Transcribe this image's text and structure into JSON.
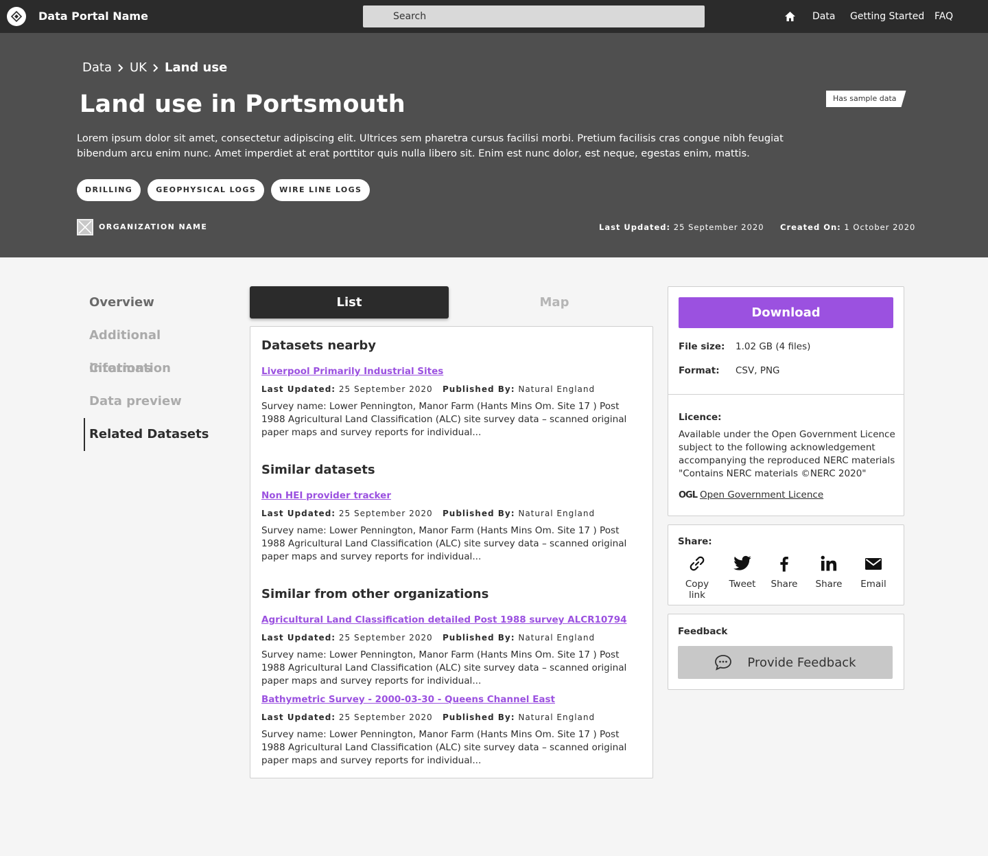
{
  "header": {
    "portal_name": "Data Portal Name",
    "search_placeholder": "Search",
    "nav": [
      "Data",
      "Getting Started",
      "FAQ"
    ]
  },
  "hero": {
    "breadcrumb": [
      "Data",
      "UK",
      "Land use"
    ],
    "title": "Land use in Portsmouth",
    "badge": "Has sample data",
    "description": "Lorem ipsum dolor sit amet, consectetur adipiscing elit. Ultrices sem pharetra cursus facilisi morbi. Pretium facilisis cras congue nibh feugiat bibendum arcu enim nunc. Amet imperdiet at erat porttitor quis nulla libero sit. Enim est nunc dolor, est neque, egestas enim, mattis.",
    "tags": [
      "DRILLING",
      "GEOPHYSICAL LOGS",
      "WIRE LINE LOGS"
    ],
    "organization": "ORGANIZATION NAME",
    "last_updated_label": "Last Updated:",
    "last_updated": "25 September 2020",
    "created_on_label": "Created On:",
    "created_on": "1 October 2020"
  },
  "sidenav": {
    "items": [
      "Overview",
      "Additional information",
      "Citations",
      "Data preview",
      "Related Datasets"
    ],
    "active": "Related Datasets"
  },
  "tabs": {
    "list": "List",
    "map": "Map"
  },
  "related": {
    "last_updated_label": "Last Updated:",
    "published_by_label": "Published By:",
    "sections": [
      {
        "title": "Datasets nearby",
        "datasets": [
          {
            "name": "Liverpool Primarily Industrial Sites",
            "last_updated": "25 September 2020",
            "publisher": "Natural England",
            "description": "Survey name: Lower Pennington, Manor Farm (Hants Mins Om. Site 17 ) Post 1988 Agricultural Land Classification (ALC) site survey data – scanned original paper maps and survey reports for individual..."
          }
        ]
      },
      {
        "title": "Similar datasets",
        "datasets": [
          {
            "name": "Non HEI provider tracker",
            "last_updated": "25 September 2020",
            "publisher": "Natural England",
            "description": "Survey name: Lower Pennington, Manor Farm (Hants Mins Om. Site 17 ) Post 1988 Agricultural Land Classification (ALC) site survey data – scanned original paper maps and survey reports for individual..."
          }
        ]
      },
      {
        "title": "Similar from other organizations",
        "datasets": [
          {
            "name": "Agricultural Land Classification detailed Post 1988 survey ALCR10794",
            "last_updated": "25 September 2020",
            "publisher": "Natural England",
            "description": "Survey name: Lower Pennington, Manor Farm (Hants Mins Om. Site 17 ) Post 1988 Agricultural Land Classification (ALC) site survey data – scanned original paper maps and survey reports for individual..."
          },
          {
            "name": "Bathymetric Survey - 2000-03-30 - Queens Channel East",
            "last_updated": "25 September 2020",
            "publisher": "Natural England",
            "description": "Survey name: Lower Pennington, Manor Farm (Hants Mins Om. Site 17 ) Post 1988 Agricultural Land Classification (ALC) site survey data – scanned original paper maps and survey reports for individual..."
          }
        ]
      }
    ]
  },
  "download": {
    "button": "Download",
    "file_size_label": "File size:",
    "file_size": "1.02 GB (4 files)",
    "format_label": "Format:",
    "format": "CSV, PNG",
    "licence_label": "Licence:",
    "licence_text": "Available under the Open Government Licence subject to the following acknowledgement accompanying the reproduced NERC materials \"Contains NERC materials ©NERC 2020\"",
    "ogl_mark": "OGL",
    "ogl_link": "Open Government Licence"
  },
  "share": {
    "label": "Share:",
    "items": [
      "Copy link",
      "Tweet",
      "Share",
      "Share",
      "Email"
    ]
  },
  "feedback": {
    "label": "Feedback",
    "button": "Provide Feedback"
  },
  "colors": {
    "accent": "#9b51e0",
    "nav_bg": "#2b2b2b",
    "hero_bg": "#4f4f4f",
    "page_bg": "#f5f5f5"
  }
}
